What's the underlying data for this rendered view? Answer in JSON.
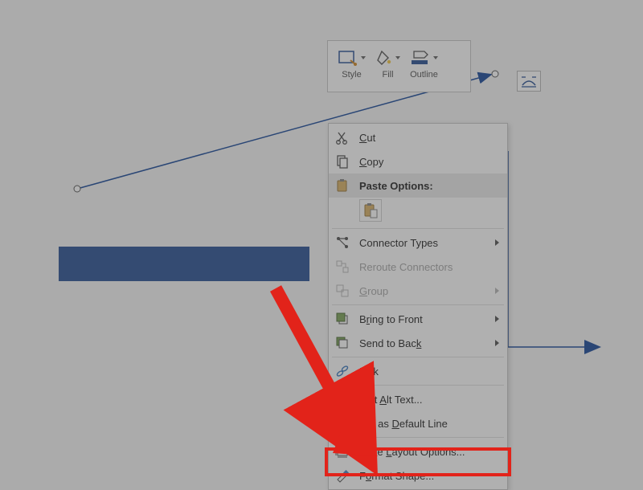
{
  "toolbar": {
    "style": "Style",
    "fill": "Fill",
    "outline": "Outline"
  },
  "menu": {
    "cut": "Cut",
    "copy": "Copy",
    "paste_header": "Paste Options:",
    "connector_types": "Connector Types",
    "reroute": "Reroute Connectors",
    "group": "Group",
    "bring_front": "Bring to Front",
    "send_back": "Send to Back",
    "link": "Link",
    "edit_alt": "Edit Alt Text...",
    "default_line": "Set as Default Line",
    "more_layout": "More Layout Options...",
    "format_shape": "Format Shape..."
  },
  "accent_blue": "#2f5597",
  "arrow_blue": "#1f4e9c",
  "red": "#e2231a"
}
